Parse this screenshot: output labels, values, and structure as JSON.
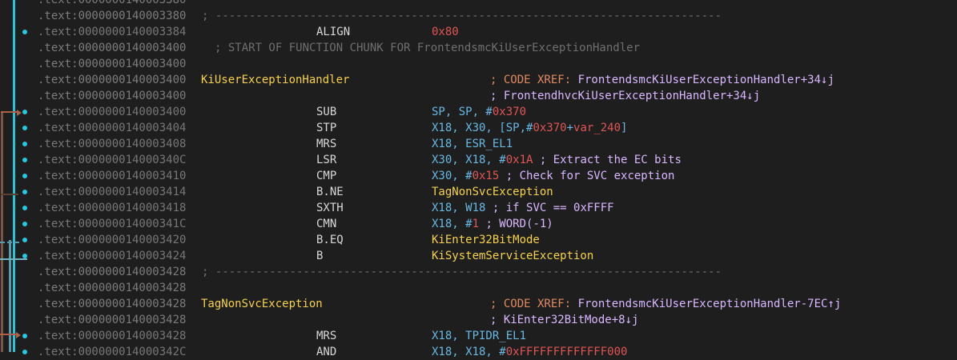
{
  "listing": {
    "lines": [
      {
        "addr": ".text:0000000140003380",
        "dot": false,
        "kind": "partial"
      },
      {
        "addr": ".text:0000000140003380",
        "dot": false,
        "kind": "separator",
        "sep": "; ---------------------------------------------------------------------------"
      },
      {
        "addr": ".text:0000000140003384",
        "dot": true,
        "kind": "instr",
        "mnem": "ALIGN",
        "ops": [
          {
            "t": "0x80",
            "c": "red"
          }
        ]
      },
      {
        "addr": ".text:0000000140003400",
        "dot": false,
        "kind": "chunk",
        "text": "; START OF FUNCTION CHUNK FOR FrontendsmcKiUserExceptionHandler"
      },
      {
        "addr": ".text:0000000140003400",
        "dot": false,
        "kind": "empty"
      },
      {
        "addr": ".text:0000000140003400",
        "dot": false,
        "kind": "label",
        "label": "KiUserExceptionHandler",
        "xref": [
          {
            "t": "; CODE XREF: ",
            "c": "orange"
          },
          {
            "t": "FrontendsmcKiUserExceptionHandler+34↓j",
            "c": "comment"
          }
        ]
      },
      {
        "addr": ".text:0000000140003400",
        "dot": false,
        "kind": "xref",
        "xref": [
          {
            "t": "; FrontendhvcKiUserExceptionHandler+34↓j",
            "c": "comment"
          }
        ]
      },
      {
        "addr": ".text:0000000140003400",
        "dot": true,
        "kind": "instr",
        "mnem": "SUB",
        "ops": [
          {
            "t": "SP, SP, #",
            "c": "blue"
          },
          {
            "t": "0x370",
            "c": "red"
          }
        ]
      },
      {
        "addr": ".text:0000000140003404",
        "dot": true,
        "kind": "instr",
        "mnem": "STP",
        "ops": [
          {
            "t": "X18, X30, [SP,#",
            "c": "blue"
          },
          {
            "t": "0x370",
            "c": "red"
          },
          {
            "t": "+",
            "c": "blue"
          },
          {
            "t": "var_240",
            "c": "red"
          },
          {
            "t": "]",
            "c": "blue"
          }
        ]
      },
      {
        "addr": ".text:0000000140003408",
        "dot": true,
        "kind": "instr",
        "mnem": "MRS",
        "ops": [
          {
            "t": "X18, ESR_EL1",
            "c": "blue"
          }
        ]
      },
      {
        "addr": ".text:000000014000340C",
        "dot": true,
        "kind": "instr",
        "mnem": "LSR",
        "ops": [
          {
            "t": "X30, X18, #",
            "c": "blue"
          },
          {
            "t": "0x1A",
            "c": "red"
          },
          {
            "t": " ; Extract the EC bits",
            "c": "comment"
          }
        ]
      },
      {
        "addr": ".text:0000000140003410",
        "dot": true,
        "kind": "instr",
        "mnem": "CMP",
        "ops": [
          {
            "t": "X30, #",
            "c": "blue"
          },
          {
            "t": "0x15",
            "c": "red"
          },
          {
            "t": " ; Check for SVC exception",
            "c": "comment"
          }
        ]
      },
      {
        "addr": ".text:0000000140003414",
        "dot": true,
        "kind": "instr",
        "mnem": "B.NE",
        "ops": [
          {
            "t": "TagNonSvcException",
            "c": "yellow"
          }
        ]
      },
      {
        "addr": ".text:0000000140003418",
        "dot": true,
        "kind": "instr",
        "mnem": "SXTH",
        "ops": [
          {
            "t": "X18, W18",
            "c": "blue"
          },
          {
            "t": " ; if SVC == 0xFFFF",
            "c": "comment"
          }
        ]
      },
      {
        "addr": ".text:000000014000341C",
        "dot": true,
        "kind": "instr",
        "mnem": "CMN",
        "ops": [
          {
            "t": "X18, #",
            "c": "blue"
          },
          {
            "t": "1",
            "c": "red"
          },
          {
            "t": " ; WORD(-1)",
            "c": "comment"
          }
        ]
      },
      {
        "addr": ".text:0000000140003420",
        "dot": true,
        "kind": "instr",
        "mnem": "B.EQ",
        "ops": [
          {
            "t": "KiEnter32BitMode",
            "c": "yellow"
          }
        ]
      },
      {
        "addr": ".text:0000000140003424",
        "dot": true,
        "kind": "instr",
        "mnem": "B",
        "ops": [
          {
            "t": "KiSystemServiceException",
            "c": "yellow"
          }
        ]
      },
      {
        "addr": ".text:0000000140003428",
        "dot": false,
        "kind": "separator",
        "sep": "; ---------------------------------------------------------------------------"
      },
      {
        "addr": ".text:0000000140003428",
        "dot": false,
        "kind": "empty"
      },
      {
        "addr": ".text:0000000140003428",
        "dot": false,
        "kind": "label",
        "label": "TagNonSvcException",
        "xref": [
          {
            "t": "; CODE XREF: ",
            "c": "orange"
          },
          {
            "t": "FrontendsmcKiUserExceptionHandler-7EC↑j",
            "c": "comment"
          }
        ]
      },
      {
        "addr": ".text:0000000140003428",
        "dot": false,
        "kind": "xref",
        "xref": [
          {
            "t": "; KiEnter32BitMode+8↓j",
            "c": "comment"
          }
        ]
      },
      {
        "addr": ".text:0000000140003428",
        "dot": true,
        "kind": "instr",
        "mnem": "MRS",
        "ops": [
          {
            "t": "X18, TPIDR_EL1",
            "c": "blue"
          }
        ]
      },
      {
        "addr": ".text:000000014000342C",
        "dot": true,
        "kind": "instr",
        "mnem": "AND",
        "ops": [
          {
            "t": "X18, X18, #",
            "c": "blue"
          },
          {
            "t": "0xFFFFFFFFFFFFF000",
            "c": "red"
          }
        ]
      }
    ]
  },
  "colors": {
    "background": "#1e1e1e",
    "flow_line": "#21c7d8",
    "segment_prefix": "#7c7c7c",
    "label": "#f5d24a",
    "register": "#68b8e4",
    "immediate": "#e05555",
    "comment": "#d9b8ff"
  }
}
